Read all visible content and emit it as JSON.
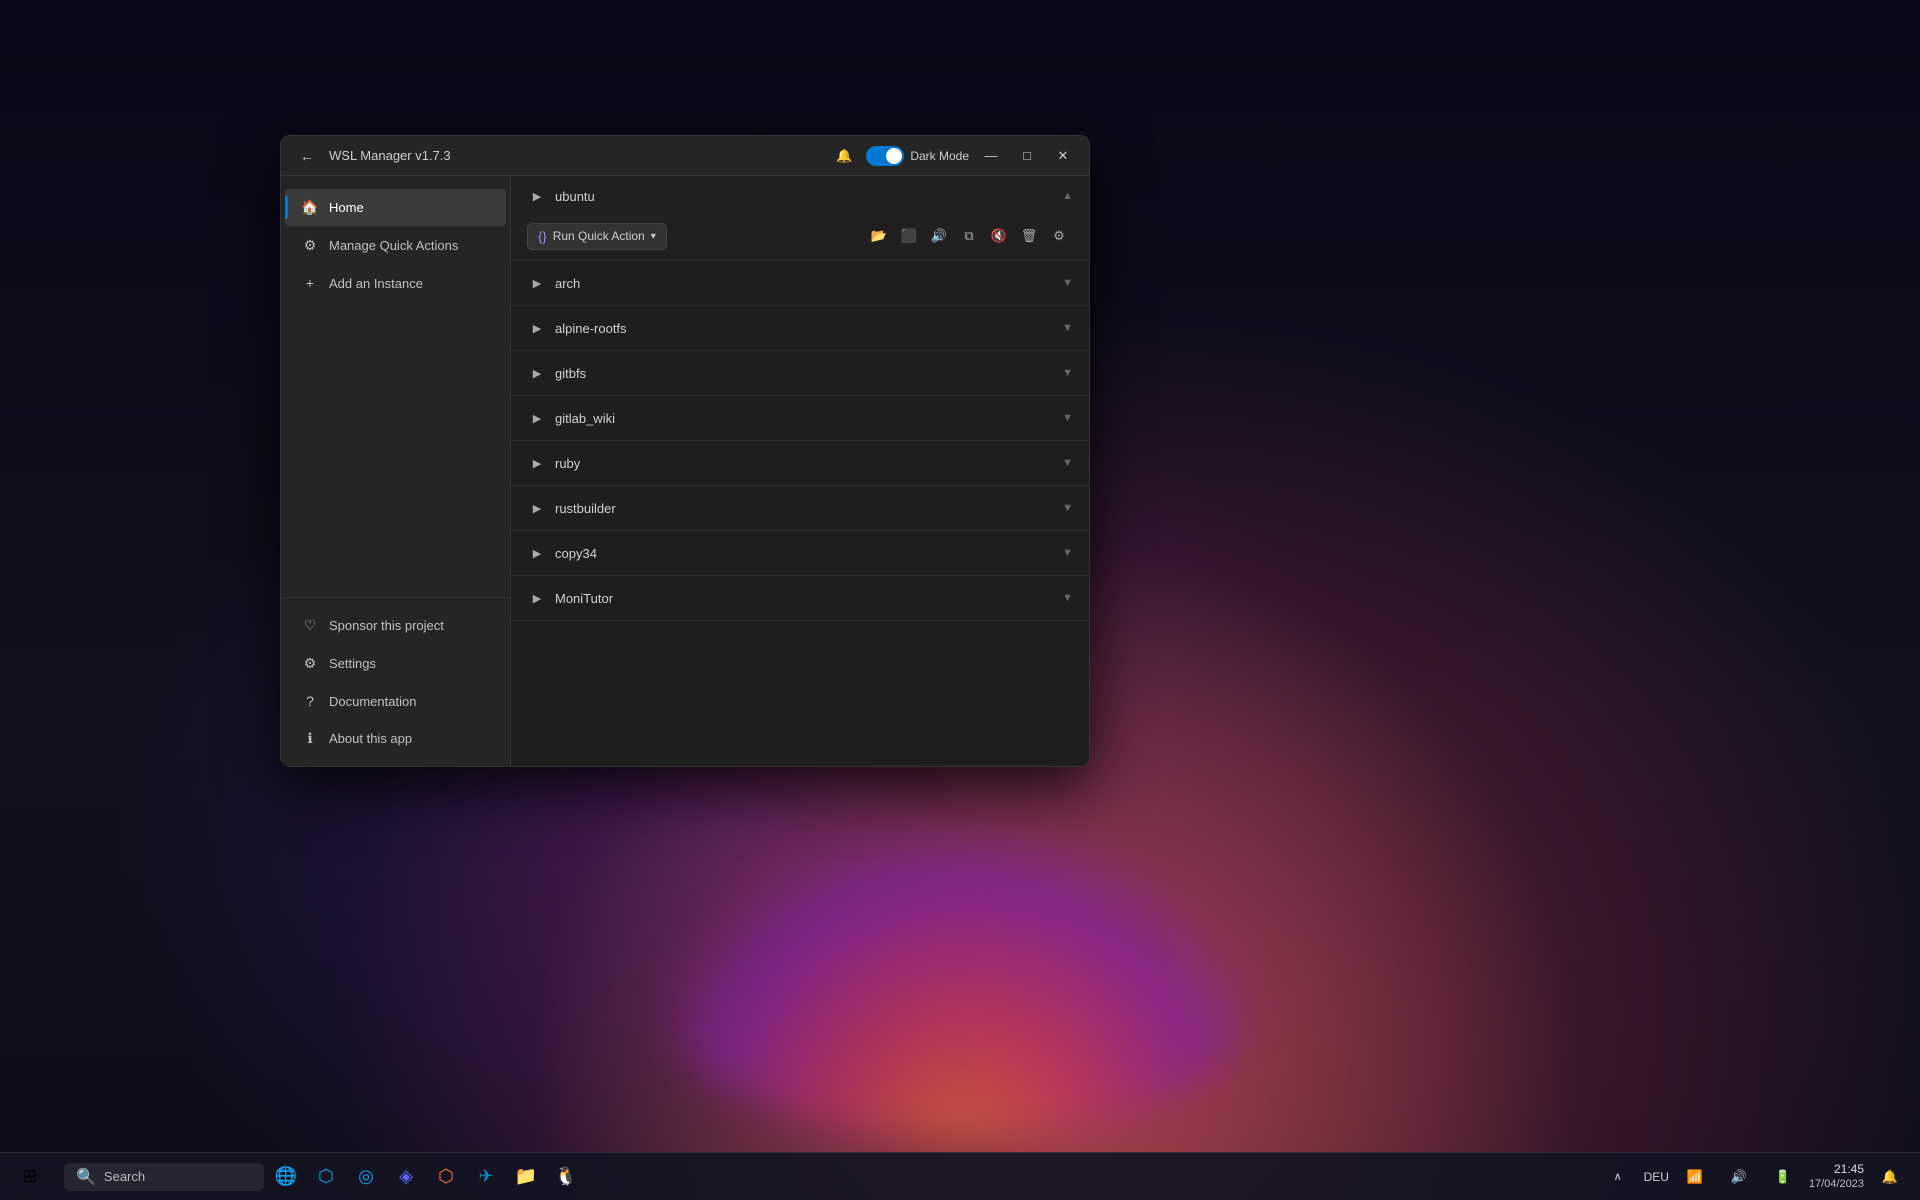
{
  "background": {
    "color": "#0a0a1a"
  },
  "app": {
    "title": "WSL Manager v1.7.3",
    "dark_mode_label": "Dark Mode",
    "dark_mode_enabled": true
  },
  "sidebar": {
    "items": [
      {
        "id": "home",
        "label": "Home",
        "icon": "🏠",
        "active": true
      },
      {
        "id": "manage-quick-actions",
        "label": "Manage Quick Actions",
        "icon": "⚙",
        "active": false
      },
      {
        "id": "add-instance",
        "label": "Add an Instance",
        "icon": "+",
        "active": false
      }
    ],
    "bottom_items": [
      {
        "id": "sponsor",
        "label": "Sponsor this project",
        "icon": "♡"
      },
      {
        "id": "settings",
        "label": "Settings",
        "icon": "⚙"
      },
      {
        "id": "documentation",
        "label": "Documentation",
        "icon": "?"
      },
      {
        "id": "about",
        "label": "About this app",
        "icon": "ℹ"
      }
    ]
  },
  "instances": [
    {
      "id": "ubuntu",
      "name": "ubuntu",
      "expanded": true,
      "actions": {
        "run_quick_action": "Run Quick Action",
        "icons": [
          "folder",
          "terminal",
          "sound",
          "copy",
          "mute",
          "delete",
          "settings"
        ]
      }
    },
    {
      "id": "arch",
      "name": "arch",
      "expanded": false
    },
    {
      "id": "alpine-rootfs",
      "name": "alpine-rootfs",
      "expanded": false
    },
    {
      "id": "gitbfs",
      "name": "gitbfs",
      "expanded": false
    },
    {
      "id": "gitlab_wiki",
      "name": "gitlab_wiki",
      "expanded": false
    },
    {
      "id": "ruby",
      "name": "ruby",
      "expanded": false
    },
    {
      "id": "rustbuilder",
      "name": "rustbuilder",
      "expanded": false
    },
    {
      "id": "copy34",
      "name": "copy34",
      "expanded": false
    },
    {
      "id": "MoniTutor",
      "name": "MoniTutor",
      "expanded": false
    }
  ],
  "titlebar": {
    "minimize": "—",
    "maximize": "□",
    "close": "✕",
    "back": "←"
  },
  "taskbar": {
    "search_label": "Search",
    "time": "21:45",
    "date": "17/04/2023",
    "language": "DEU",
    "icons": [
      "⊞",
      "🔍",
      "🌐",
      "📁",
      "🔔"
    ]
  }
}
